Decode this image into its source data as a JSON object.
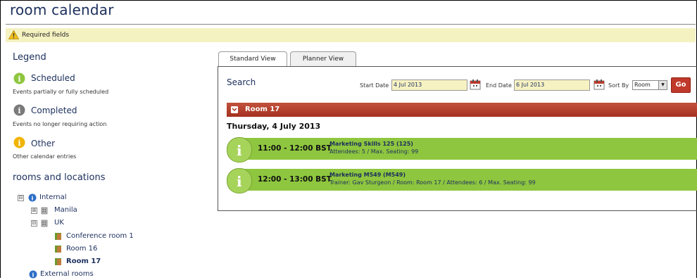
{
  "header": {
    "title": "room calendar",
    "required_text": "Required fields"
  },
  "legend": {
    "heading": "Legend",
    "items": [
      {
        "label": "Scheduled",
        "description": "Events partially or fully scheduled",
        "color": "#8ec63f"
      },
      {
        "label": "Completed",
        "description": "Events no longer requiring action",
        "color": "#7a7a7a"
      },
      {
        "label": "Other",
        "description": "Other calendar entries",
        "color": "#f0b400"
      }
    ]
  },
  "rooms": {
    "heading": "rooms and locations",
    "tree": [
      {
        "label": "Internal",
        "toggle": "⊟",
        "icon": "info-icon"
      },
      {
        "label": "Manila",
        "toggle": "⊞",
        "icon": "building-icon"
      },
      {
        "label": "UK",
        "toggle": "⊟",
        "icon": "building-icon"
      },
      {
        "label": "Conference room 1",
        "icon": "door-icon"
      },
      {
        "label": "Room 16",
        "icon": "door-icon"
      },
      {
        "label": "Room 17",
        "icon": "door-icon",
        "selected": true
      },
      {
        "label": "External rooms",
        "icon": "info-icon"
      }
    ]
  },
  "tabs": [
    {
      "label": "Standard View",
      "active": true
    },
    {
      "label": "Planner View",
      "active": false
    }
  ],
  "search": {
    "label": "Search",
    "start_label": "Start Date",
    "start_value": "4 Jul 2013",
    "end_label": "End Date",
    "end_value": "6 Jul 2013",
    "sort_label": "Sort By",
    "sort_value": "Room",
    "go_label": "Go"
  },
  "room_bar": {
    "label": "Room 17"
  },
  "day_heading": "Thursday, 4 July 2013",
  "events": [
    {
      "time": "11:00 - 12:00 BST",
      "name": "Marketing Skills 125 (125)",
      "detail": "Attendees: 5 / Max. Seating: 99"
    },
    {
      "time": "12:00 - 13:00 BST",
      "name": "Marketing M549 (M549)",
      "detail": "Trainer: Gav Sturgeon / Room: Room 17 / Attendees: 6 / Max. Seating: 99"
    }
  ]
}
